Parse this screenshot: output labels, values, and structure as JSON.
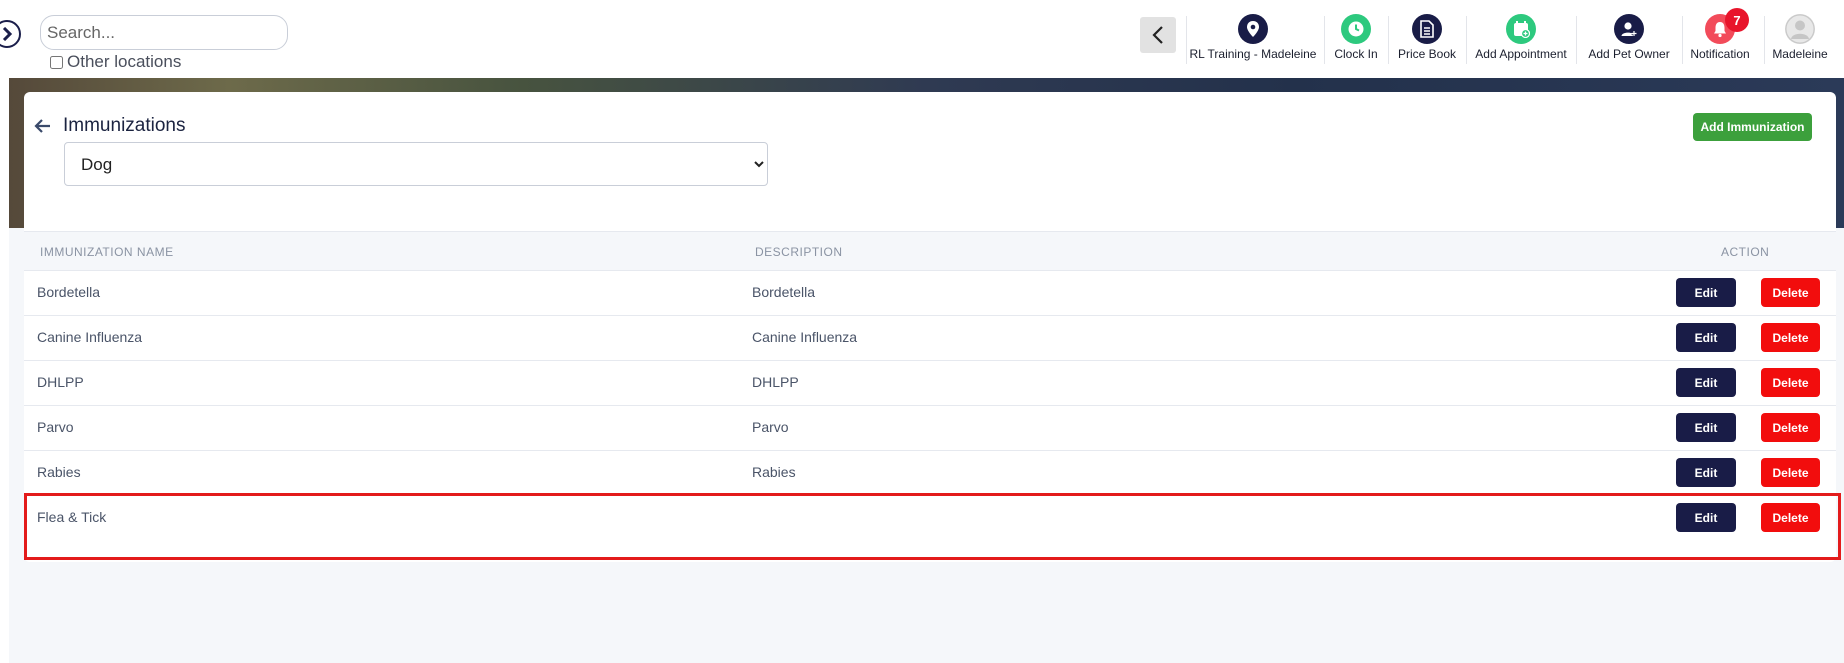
{
  "search": {
    "placeholder": "Search..."
  },
  "other_locations_label": "Other locations",
  "nav": [
    {
      "label": "RL Training - Madeleine",
      "icon": "location-pin-icon",
      "color": "#191c47"
    },
    {
      "label": "Clock In",
      "icon": "clock-icon",
      "color": "#2dc97e"
    },
    {
      "label": "Price Book",
      "icon": "document-icon",
      "color": "#191c47"
    },
    {
      "label": "Add Appointment",
      "icon": "calendar-add-icon",
      "color": "#2dc97e"
    },
    {
      "label": "Add Pet Owner",
      "icon": "user-add-icon",
      "color": "#191c47"
    },
    {
      "label": "Notification",
      "icon": "bell-icon",
      "color": "#f24b5a",
      "badge": "7"
    },
    {
      "label": "Madeleine",
      "icon": "avatar-icon",
      "color": "#c8c8c8"
    }
  ],
  "page": {
    "title": "Immunizations",
    "add_button": "Add Immunization",
    "species_selected": "Dog"
  },
  "table": {
    "headers": {
      "name": "IMMUNIZATION NAME",
      "description": "DESCRIPTION",
      "action": "ACTION"
    },
    "edit_label": "Edit",
    "delete_label": "Delete",
    "rows": [
      {
        "name": "Bordetella",
        "description": "Bordetella"
      },
      {
        "name": "Canine Influenza",
        "description": "Canine Influenza"
      },
      {
        "name": "DHLPP",
        "description": "DHLPP"
      },
      {
        "name": "Parvo",
        "description": "Parvo"
      },
      {
        "name": "Rabies",
        "description": "Rabies"
      },
      {
        "name": "Flea & Tick",
        "description": ""
      }
    ]
  },
  "colors": {
    "navy": "#191c47",
    "green": "#3ca03c",
    "red": "#f20d0d",
    "highlight": "#e31b1b"
  }
}
